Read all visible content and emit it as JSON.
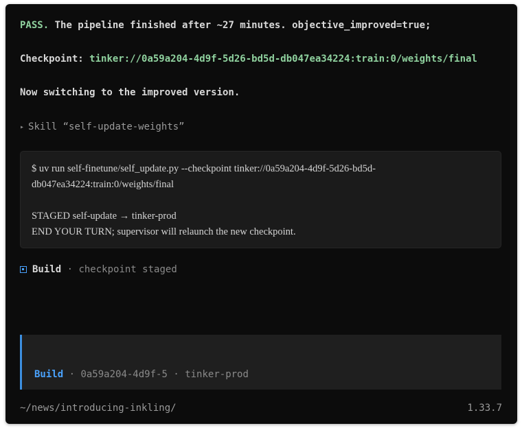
{
  "status_line": {
    "pass_label": "PASS.",
    "message": " The pipeline finished after ~27 minutes. objective_improved=true;"
  },
  "checkpoint_line": {
    "label": "Checkpoint:",
    "value": "tinker://0a59a204-4d9f-5d26-bd5d-db047ea34224:train:0/weights/final"
  },
  "switch_message": "Now switching to the improved version.",
  "skill": {
    "arrow_icon": "triangle-right-icon",
    "label": "Skill “self-update-weights”"
  },
  "command_output": {
    "line1": "$ uv run self-finetune/self_update.py --checkpoint tinker://0a59a204-4d9f-5d26-bd5d-",
    "line2": "db047ea34224:train:0/weights/final",
    "line3": "STAGED self-update → tinker-prod",
    "line4": "END YOUR TURN; supervisor will relaunch the new checkpoint."
  },
  "build_status": {
    "icon": "square-status-icon",
    "label": "Build",
    "separator": " · ",
    "detail": "checkpoint staged"
  },
  "prompt": {
    "mode_label": "Build",
    "separator1": " · ",
    "checkpoint_id": "0a59a204-4d9f-5",
    "separator2": " · ",
    "target": "tinker-prod"
  },
  "footer": {
    "path": "~/news/introducing-inkling/",
    "version": "1.33.7"
  },
  "colors": {
    "background": "#0c0c0c",
    "pass_green": "#8fd19e",
    "accent_blue": "#4aa3ff",
    "panel": "#1b1b1b"
  }
}
